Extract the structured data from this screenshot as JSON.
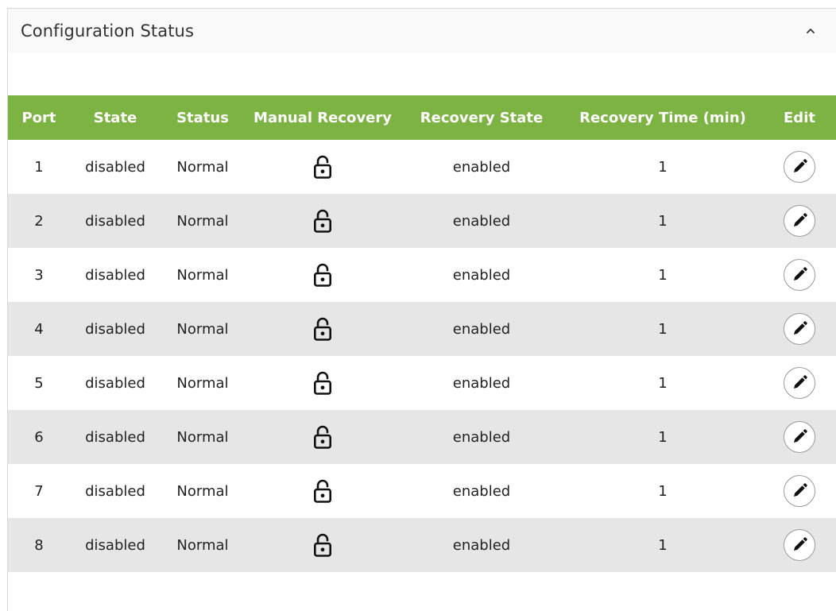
{
  "panel": {
    "title": "Configuration Status",
    "collapse_icon": "chevron-up-icon"
  },
  "table": {
    "columns": [
      "Port",
      "State",
      "Status",
      "Manual Recovery",
      "Recovery State",
      "Recovery Time (min)",
      "Edit"
    ],
    "rows": [
      {
        "port": "1",
        "state": "disabled",
        "status": "Normal",
        "manual_recovery_icon": "unlocked-padlock-icon",
        "recovery_state": "enabled",
        "recovery_time": "1",
        "edit_icon": "pencil-icon"
      },
      {
        "port": "2",
        "state": "disabled",
        "status": "Normal",
        "manual_recovery_icon": "unlocked-padlock-icon",
        "recovery_state": "enabled",
        "recovery_time": "1",
        "edit_icon": "pencil-icon"
      },
      {
        "port": "3",
        "state": "disabled",
        "status": "Normal",
        "manual_recovery_icon": "unlocked-padlock-icon",
        "recovery_state": "enabled",
        "recovery_time": "1",
        "edit_icon": "pencil-icon"
      },
      {
        "port": "4",
        "state": "disabled",
        "status": "Normal",
        "manual_recovery_icon": "unlocked-padlock-icon",
        "recovery_state": "enabled",
        "recovery_time": "1",
        "edit_icon": "pencil-icon"
      },
      {
        "port": "5",
        "state": "disabled",
        "status": "Normal",
        "manual_recovery_icon": "unlocked-padlock-icon",
        "recovery_state": "enabled",
        "recovery_time": "1",
        "edit_icon": "pencil-icon"
      },
      {
        "port": "6",
        "state": "disabled",
        "status": "Normal",
        "manual_recovery_icon": "unlocked-padlock-icon",
        "recovery_state": "enabled",
        "recovery_time": "1",
        "edit_icon": "pencil-icon"
      },
      {
        "port": "7",
        "state": "disabled",
        "status": "Normal",
        "manual_recovery_icon": "unlocked-padlock-icon",
        "recovery_state": "enabled",
        "recovery_time": "1",
        "edit_icon": "pencil-icon"
      },
      {
        "port": "8",
        "state": "disabled",
        "status": "Normal",
        "manual_recovery_icon": "unlocked-padlock-icon",
        "recovery_state": "enabled",
        "recovery_time": "1",
        "edit_icon": "pencil-icon"
      }
    ]
  },
  "colors": {
    "header_green": "#7cb342",
    "stripe_gray": "#e6e6e6",
    "panel_header_bg": "#f9f9f9"
  }
}
